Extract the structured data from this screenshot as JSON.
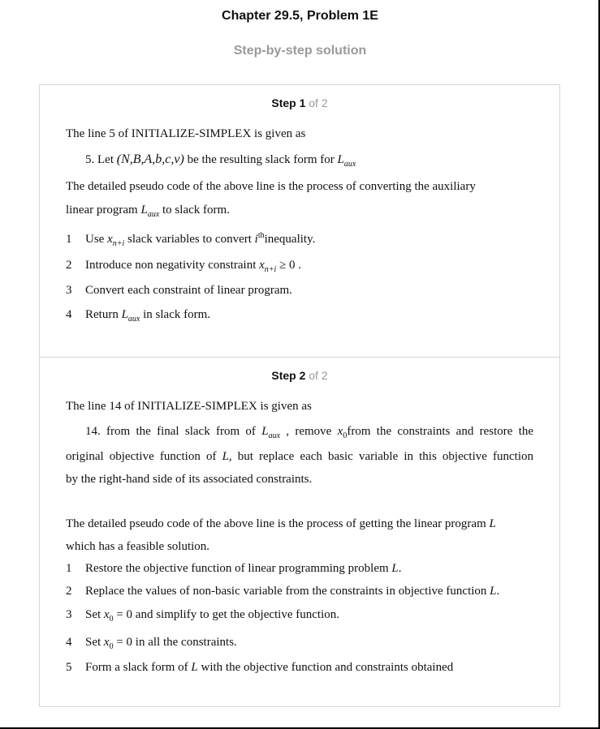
{
  "header": {
    "title": "Chapter 29.5, Problem 1E",
    "subtitle": "Step-by-step solution"
  },
  "steps": [
    {
      "label": "Step 1",
      "of": "of 2",
      "intro": "The line 5 of INITIALIZE-SIMPLEX is given as",
      "quote": {
        "prefix": "5. Let",
        "tuple": "(N,B,A,b,c,v)",
        "mid": "be the resulting slack form for",
        "var": "L",
        "var_sub": "aux"
      },
      "para_a": "The detailed pseudo code of the above line is the process of converting the auxiliary",
      "para_b_prefix": "linear program",
      "para_b_var": "L",
      "para_b_sub": "aux",
      "para_b_suffix": "to slack form.",
      "items": [
        {
          "n": "1",
          "pre": "Use",
          "var": "x",
          "sub": "n+i",
          "mid": "slack variables to convert",
          "var2": "i",
          "sup": "th",
          "post": "inequality."
        },
        {
          "n": "2",
          "pre": "Introduce non negativity constraint",
          "var": "x",
          "sub": "n+i",
          "post": "≥ 0 ."
        },
        {
          "n": "3",
          "text": "Convert each constraint of linear program."
        },
        {
          "n": "4",
          "pre": "Return",
          "var": "L",
          "sub": "aux",
          "post": "in slack form."
        }
      ]
    },
    {
      "label": "Step 2",
      "of": "of 2",
      "intro": "The line 14 of INITIALIZE-SIMPLEX is given as",
      "quote_1_a": "14. from the final slack from of",
      "quote_1_var": "L",
      "quote_1_sub": "aux",
      "quote_1_b": ", remove",
      "quote_1_var2": "x",
      "quote_1_sub2": "0",
      "quote_1_c": "from the constraints and restore the",
      "quote_2_a": "original objective function of",
      "quote_2_var": "L",
      "quote_2_b": ", but replace each basic variable in this objective function",
      "quote_3": "by the right-hand side of its associated constraints.",
      "para_a_prefix": "The detailed pseudo code of the above line is the process of getting the linear program",
      "para_a_var": "L",
      "para_b": "which has a feasible solution.",
      "items": [
        {
          "n": "1",
          "pre": "Restore the objective function of linear programming problem",
          "var": "L",
          "post": "."
        },
        {
          "n": "2",
          "pre": "Replace the values of non-basic variable from the constraints in objective function",
          "var": "L",
          "post": "."
        },
        {
          "n": "3",
          "pre": "Set",
          "var": "x",
          "sub": "0",
          "post": "= 0 and simplify to get the objective function."
        },
        {
          "n": "4",
          "pre": "Set",
          "var": "x",
          "sub": "0",
          "post": "= 0 in all the constraints."
        },
        {
          "n": "5",
          "pre": "Form a slack form of",
          "var": "L",
          "post": "with the objective function and constraints obtained"
        }
      ]
    }
  ]
}
